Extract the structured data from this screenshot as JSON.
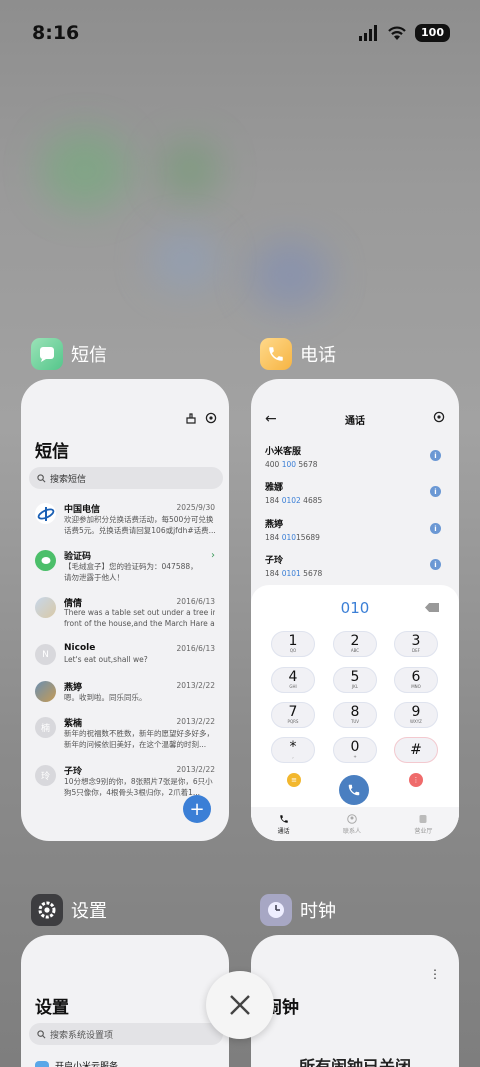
{
  "status": {
    "time": "8:16",
    "battery": "100"
  },
  "cards": {
    "sms": {
      "app_name": "短信",
      "title": "短信",
      "search_placeholder": "搜索短信",
      "messages": [
        {
          "name": "中国电信",
          "date": "2025/9/30",
          "line1": "欢迎参加积分兑换话费活动，每500分可兑换",
          "line2": "话费5元。兑换话费请回复106或jfdh#话费..."
        },
        {
          "name": "验证码",
          "date": "",
          "line1": "【毛绒盒子】您的验证码为：047588，",
          "line2": "请勿泄露于他人！"
        },
        {
          "name": "倩倩",
          "date": "2016/6/13",
          "line1": "There was a table set out under a tree in",
          "line2": "front of the house,and the March Hare an..."
        },
        {
          "name": "Nicole",
          "date": "2016/6/13",
          "line1": "Let's eat out,shall we?",
          "line2": ""
        },
        {
          "name": "燕婷",
          "date": "2013/2/22",
          "line1": "嗯。收到啦。同乐同乐。",
          "line2": ""
        },
        {
          "name": "紫楠",
          "date": "2013/2/22",
          "line1": "新年的祝福数不胜数，新年的愿望好多好多，",
          "line2": "新年的问候依旧美好，在这个温馨的时刻..."
        },
        {
          "name": "子玲",
          "date": "2013/2/22",
          "line1": "10分想念9别的你，8张照片7张是你，6只小",
          "line2": "狗5只像你，4根骨头3根归你，2爪着1..."
        }
      ],
      "avatar_letters": [
        "",
        "",
        "",
        "N",
        "",
        "楠",
        "玲"
      ],
      "fab": "+"
    },
    "phone": {
      "app_name": "电话",
      "title": "通话",
      "contacts": [
        {
          "name": "小米客服",
          "num_a": "400 ",
          "num_hl": "100",
          "num_b": " 5678"
        },
        {
          "name": "雅娜",
          "num_a": "184 ",
          "num_hl": "0102",
          "num_b": " 4685"
        },
        {
          "name": "燕婷",
          "num_a": "184 ",
          "num_hl": "010",
          "num_b": "15689"
        },
        {
          "name": "子玲",
          "num_a": "184 ",
          "num_hl": "0101",
          "num_b": " 5678"
        }
      ],
      "dialed": "010",
      "keys": [
        {
          "d": "1",
          "l": "QO"
        },
        {
          "d": "2",
          "l": "ABC"
        },
        {
          "d": "3",
          "l": "DEF"
        },
        {
          "d": "4",
          "l": "GHI"
        },
        {
          "d": "5",
          "l": "JKL"
        },
        {
          "d": "6",
          "l": "MNO"
        },
        {
          "d": "7",
          "l": "PQRS"
        },
        {
          "d": "8",
          "l": "TUV"
        },
        {
          "d": "9",
          "l": "WXYZ"
        },
        {
          "d": "*",
          "l": ","
        },
        {
          "d": "0",
          "l": "+"
        },
        {
          "d": "#",
          "l": ""
        }
      ],
      "tabs": [
        "通话",
        "联系人",
        "营业厅"
      ],
      "colors": {
        "accent": "#3b7fd6",
        "call": "#4a7fc1"
      }
    },
    "settings": {
      "app_name": "设置",
      "title": "设置",
      "search_placeholder": "搜索系统设置项",
      "first_item": "开启小米云服务"
    },
    "clock": {
      "app_name": "时钟",
      "title": "闹钟",
      "empty_text": "所有闹钟已关闭"
    }
  }
}
